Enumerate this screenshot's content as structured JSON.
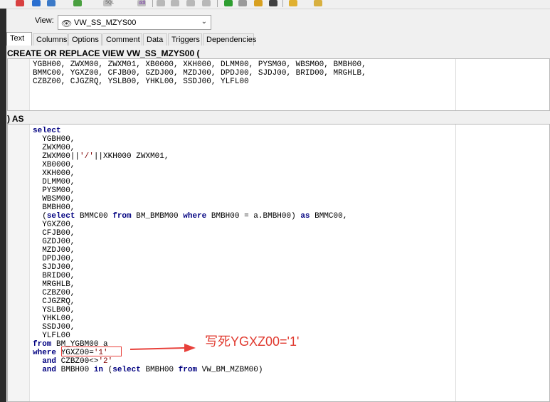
{
  "toolbar": {
    "icons": [
      "record-icon",
      "add-icon",
      "refresh-icon",
      "sql-icon",
      "ddl-icon",
      "run-icon",
      "debug-icon",
      "compile-icon",
      "find-icon",
      "help-icon"
    ],
    "sql_label": "SQL",
    "ddl_label": "ddl"
  },
  "view": {
    "label": "View:",
    "value": "VW_SS_MZYS00",
    "icon": "view-eye-icon"
  },
  "tabs": [
    "Text",
    "Columns",
    "Options",
    "Comment",
    "Data",
    "Triggers",
    "Dependencies"
  ],
  "header": "CREATE OR REPLACE VIEW VW_SS_MZYS00 (",
  "columns_lines": [
    "YGBH00, ZWXM00, ZWXM01, XB0000, XKH000, DLMM00, PYSM00, WBSM00, BMBH00,",
    "BMMC00, YGXZ00, CFJB00, GZDJ00, MZDJ00, DPDJ00, SJDJ00, BRID00, MRGHLB,",
    "CZBZ00, CJGZRQ, YSLB00, YHKL00, SSDJ00, YLFL00"
  ],
  "as_label": ") AS",
  "sql": {
    "select_kw": "select",
    "fields_a": [
      "YGBH00,",
      "ZWXM00,"
    ],
    "concat": {
      "a": "ZWXM00||",
      "b": "'/'",
      "c": "||XKH000 ZWXM01,"
    },
    "fields_b": [
      "XB0000,",
      "XKH000,",
      "DLMM00,",
      "PYSM00,",
      "WBSM00,",
      "BMBH00,"
    ],
    "subquery": {
      "open": "(",
      "select_kw": "select",
      "t1": " BMMC00 ",
      "from_kw": "from",
      "t2": " BM_BMBM00 ",
      "where_kw": "where",
      "t3": " BMBH00 = a.BMBH00) ",
      "as_kw": "as",
      "t4": " BMMC00,"
    },
    "fields_c": [
      "YGXZ00,",
      "CFJB00,",
      "GZDJ00,",
      "MZDJ00,",
      "DPDJ00,",
      "SJDJ00,",
      "BRID00,",
      "MRGHLB,",
      "CZBZ00,",
      "CJGZRQ,",
      "YSLB00,",
      "YHKL00,",
      "SSDJ00,",
      "YLFL00"
    ],
    "from_line": {
      "kw": "from",
      "rest": " BM_YGBM00 a"
    },
    "where_line": {
      "kw": "where",
      "col": " YGXZ00=",
      "val": "'1'"
    },
    "and1": {
      "kw": "and",
      "col": " CZBZ00<>",
      "val": "'2'"
    },
    "and2": {
      "kw": "and",
      "t1": " BMBH00 ",
      "in_kw": "in",
      "t2": " (",
      "select_kw": "select",
      "t3": " BMBH00 ",
      "from_kw": "from",
      "t4": " VW_BM_MZBM00)"
    }
  },
  "annotation": "写死YGXZ00='1'",
  "colors": {
    "keyword": "#000080",
    "string": "#800000",
    "annotation": "#e03a2f"
  }
}
